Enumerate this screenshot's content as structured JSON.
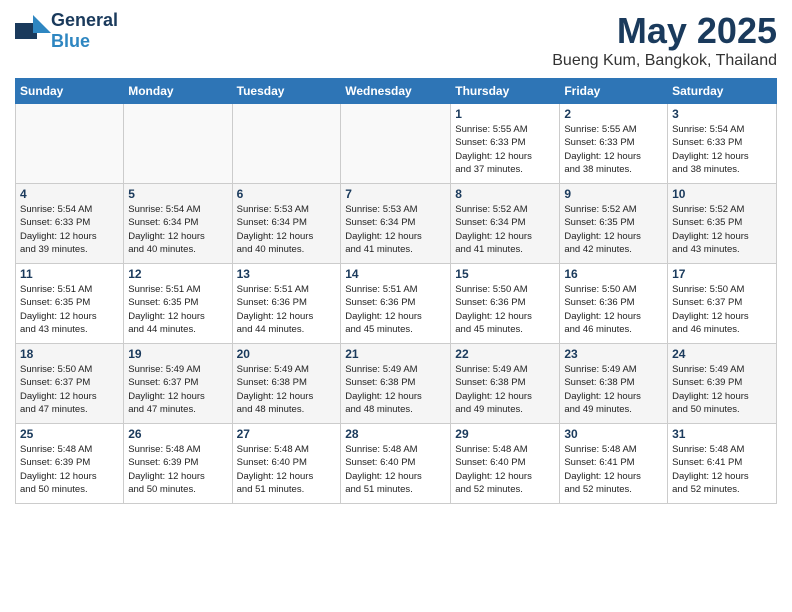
{
  "header": {
    "logo_general": "General",
    "logo_blue": "Blue",
    "title": "May 2025",
    "subtitle": "Bueng Kum, Bangkok, Thailand"
  },
  "days_of_week": [
    "Sunday",
    "Monday",
    "Tuesday",
    "Wednesday",
    "Thursday",
    "Friday",
    "Saturday"
  ],
  "weeks": [
    {
      "days": [
        {
          "num": "",
          "info": ""
        },
        {
          "num": "",
          "info": ""
        },
        {
          "num": "",
          "info": ""
        },
        {
          "num": "",
          "info": ""
        },
        {
          "num": "1",
          "info": "Sunrise: 5:55 AM\nSunset: 6:33 PM\nDaylight: 12 hours\nand 37 minutes."
        },
        {
          "num": "2",
          "info": "Sunrise: 5:55 AM\nSunset: 6:33 PM\nDaylight: 12 hours\nand 38 minutes."
        },
        {
          "num": "3",
          "info": "Sunrise: 5:54 AM\nSunset: 6:33 PM\nDaylight: 12 hours\nand 38 minutes."
        }
      ]
    },
    {
      "days": [
        {
          "num": "4",
          "info": "Sunrise: 5:54 AM\nSunset: 6:33 PM\nDaylight: 12 hours\nand 39 minutes."
        },
        {
          "num": "5",
          "info": "Sunrise: 5:54 AM\nSunset: 6:34 PM\nDaylight: 12 hours\nand 40 minutes."
        },
        {
          "num": "6",
          "info": "Sunrise: 5:53 AM\nSunset: 6:34 PM\nDaylight: 12 hours\nand 40 minutes."
        },
        {
          "num": "7",
          "info": "Sunrise: 5:53 AM\nSunset: 6:34 PM\nDaylight: 12 hours\nand 41 minutes."
        },
        {
          "num": "8",
          "info": "Sunrise: 5:52 AM\nSunset: 6:34 PM\nDaylight: 12 hours\nand 41 minutes."
        },
        {
          "num": "9",
          "info": "Sunrise: 5:52 AM\nSunset: 6:35 PM\nDaylight: 12 hours\nand 42 minutes."
        },
        {
          "num": "10",
          "info": "Sunrise: 5:52 AM\nSunset: 6:35 PM\nDaylight: 12 hours\nand 43 minutes."
        }
      ]
    },
    {
      "days": [
        {
          "num": "11",
          "info": "Sunrise: 5:51 AM\nSunset: 6:35 PM\nDaylight: 12 hours\nand 43 minutes."
        },
        {
          "num": "12",
          "info": "Sunrise: 5:51 AM\nSunset: 6:35 PM\nDaylight: 12 hours\nand 44 minutes."
        },
        {
          "num": "13",
          "info": "Sunrise: 5:51 AM\nSunset: 6:36 PM\nDaylight: 12 hours\nand 44 minutes."
        },
        {
          "num": "14",
          "info": "Sunrise: 5:51 AM\nSunset: 6:36 PM\nDaylight: 12 hours\nand 45 minutes."
        },
        {
          "num": "15",
          "info": "Sunrise: 5:50 AM\nSunset: 6:36 PM\nDaylight: 12 hours\nand 45 minutes."
        },
        {
          "num": "16",
          "info": "Sunrise: 5:50 AM\nSunset: 6:36 PM\nDaylight: 12 hours\nand 46 minutes."
        },
        {
          "num": "17",
          "info": "Sunrise: 5:50 AM\nSunset: 6:37 PM\nDaylight: 12 hours\nand 46 minutes."
        }
      ]
    },
    {
      "days": [
        {
          "num": "18",
          "info": "Sunrise: 5:50 AM\nSunset: 6:37 PM\nDaylight: 12 hours\nand 47 minutes."
        },
        {
          "num": "19",
          "info": "Sunrise: 5:49 AM\nSunset: 6:37 PM\nDaylight: 12 hours\nand 47 minutes."
        },
        {
          "num": "20",
          "info": "Sunrise: 5:49 AM\nSunset: 6:38 PM\nDaylight: 12 hours\nand 48 minutes."
        },
        {
          "num": "21",
          "info": "Sunrise: 5:49 AM\nSunset: 6:38 PM\nDaylight: 12 hours\nand 48 minutes."
        },
        {
          "num": "22",
          "info": "Sunrise: 5:49 AM\nSunset: 6:38 PM\nDaylight: 12 hours\nand 49 minutes."
        },
        {
          "num": "23",
          "info": "Sunrise: 5:49 AM\nSunset: 6:38 PM\nDaylight: 12 hours\nand 49 minutes."
        },
        {
          "num": "24",
          "info": "Sunrise: 5:49 AM\nSunset: 6:39 PM\nDaylight: 12 hours\nand 50 minutes."
        }
      ]
    },
    {
      "days": [
        {
          "num": "25",
          "info": "Sunrise: 5:48 AM\nSunset: 6:39 PM\nDaylight: 12 hours\nand 50 minutes."
        },
        {
          "num": "26",
          "info": "Sunrise: 5:48 AM\nSunset: 6:39 PM\nDaylight: 12 hours\nand 50 minutes."
        },
        {
          "num": "27",
          "info": "Sunrise: 5:48 AM\nSunset: 6:40 PM\nDaylight: 12 hours\nand 51 minutes."
        },
        {
          "num": "28",
          "info": "Sunrise: 5:48 AM\nSunset: 6:40 PM\nDaylight: 12 hours\nand 51 minutes."
        },
        {
          "num": "29",
          "info": "Sunrise: 5:48 AM\nSunset: 6:40 PM\nDaylight: 12 hours\nand 52 minutes."
        },
        {
          "num": "30",
          "info": "Sunrise: 5:48 AM\nSunset: 6:41 PM\nDaylight: 12 hours\nand 52 minutes."
        },
        {
          "num": "31",
          "info": "Sunrise: 5:48 AM\nSunset: 6:41 PM\nDaylight: 12 hours\nand 52 minutes."
        }
      ]
    }
  ]
}
